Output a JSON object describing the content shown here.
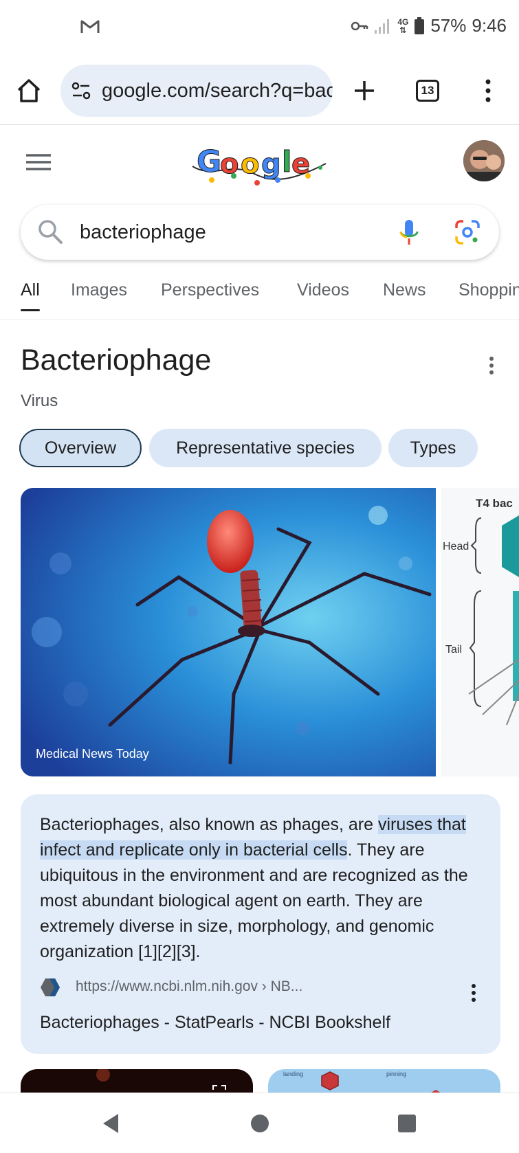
{
  "status_bar": {
    "network": "4G",
    "battery": "57%",
    "time": "9:46"
  },
  "browser": {
    "url": "google.com/search?q=bacteriophage",
    "tab_count": "13"
  },
  "search": {
    "query": "bacteriophage",
    "tabs": [
      {
        "label": "All",
        "active": true
      },
      {
        "label": "Images"
      },
      {
        "label": "Perspectives"
      },
      {
        "label": "Videos"
      },
      {
        "label": "News"
      },
      {
        "label": "Shopping"
      }
    ]
  },
  "knowledge_panel": {
    "title": "Bacteriophage",
    "subtitle": "Virus",
    "chips": [
      "Overview",
      "Representative species",
      "Types"
    ],
    "image_caption": "Medical News Today",
    "diagram_labels": {
      "title": "T4 bac",
      "head": "Head",
      "tail": "Tail"
    }
  },
  "description": {
    "part1": "Bacteriophages, also known as phages, are ",
    "highlight": "viruses that infect and replicate only in bacterial cells",
    "part2": ". They are ubiquitous in the environment and are recognized as the most abundant biological agent on earth. They are extremely diverse in size, morphology, and genomic organization [1][2][3].",
    "source_url": "https://www.ncbi.nlm.nih.gov › NB...",
    "source_title": "Bacteriophages - StatPearls - NCBI Bookshelf"
  },
  "thumbnails": {
    "right_labels": [
      "landing",
      "pinning"
    ]
  },
  "colors": {
    "accent_blue": "#1a73e8",
    "card_bg": "#e3edf9",
    "chip_bg": "#dbe7f7"
  }
}
